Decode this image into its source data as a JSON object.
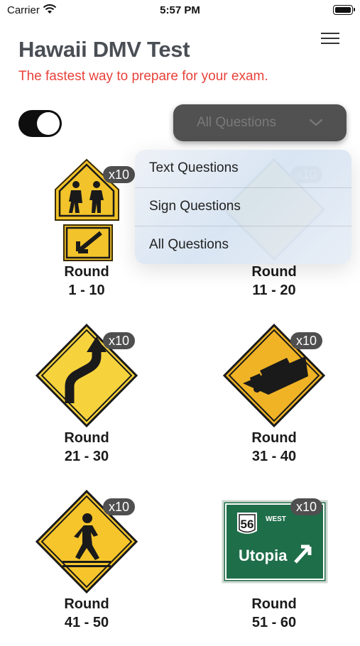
{
  "status_bar": {
    "carrier": "Carrier",
    "time": "5:57 PM"
  },
  "header": {
    "title": "Hawaii DMV Test",
    "subtitle": "The fastest way to prepare for your exam."
  },
  "controls": {
    "toggle_on": true,
    "filter_value": "All Questions"
  },
  "dropdown": {
    "options": [
      "Text Questions",
      "Sign Questions",
      "All Questions"
    ]
  },
  "rounds": [
    {
      "label": "Round",
      "range": "1 - 10",
      "count": "x10",
      "sign": "school-crossing-sign-icon"
    },
    {
      "label": "Round",
      "range": "11 - 20",
      "count": "x10",
      "sign": "steep-grade-sign-icon"
    },
    {
      "label": "Round",
      "range": "21 - 30",
      "count": "x10",
      "sign": "curve-arrow-sign-icon"
    },
    {
      "label": "Round",
      "range": "31 - 40",
      "count": "x10",
      "sign": "truck-hill-sign-icon"
    },
    {
      "label": "Round",
      "range": "41 - 50",
      "count": "x10",
      "sign": "pedestrian-crossing-sign-icon"
    },
    {
      "label": "Round",
      "range": "51 - 60",
      "count": "x10",
      "sign": "highway-guide-sign-icon"
    }
  ],
  "guide_sign": {
    "route": "56",
    "direction": "WEST",
    "destination": "Utopia"
  },
  "colors": {
    "accent_red": "#e8423a",
    "title_gray": "#4a4e55",
    "sign_yellow": "#f6d33c",
    "guide_green": "#1f6e4a"
  }
}
